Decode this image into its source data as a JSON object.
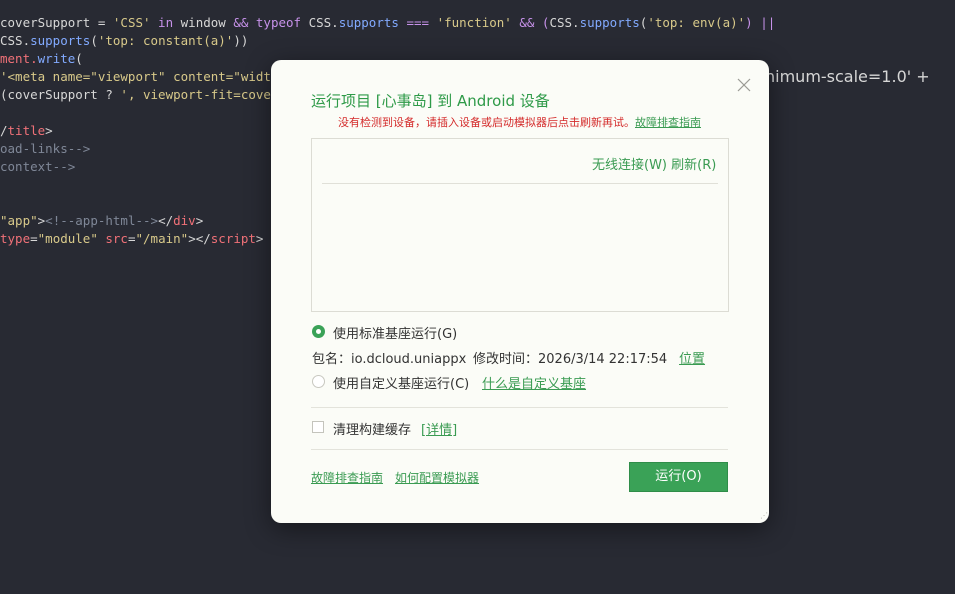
{
  "editor": {
    "lines": [
      {
        "tokens": [
          {
            "t": "coverSupport = ",
            "c": "plain"
          },
          {
            "t": "'CSS'",
            "c": "str"
          },
          {
            "t": " in ",
            "c": "kw"
          },
          {
            "t": "window ",
            "c": "plain"
          },
          {
            "t": "&& ",
            "c": "op"
          },
          {
            "t": "typeof ",
            "c": "kw"
          },
          {
            "t": "CSS.",
            "c": "plain"
          },
          {
            "t": "supports",
            "c": "fn"
          },
          {
            "t": " === ",
            "c": "op"
          },
          {
            "t": "'function'",
            "c": "str"
          },
          {
            "t": " && (",
            "c": "op"
          },
          {
            "t": "CSS.",
            "c": "plain"
          },
          {
            "t": "supports",
            "c": "fn"
          },
          {
            "t": "(",
            "c": "plain"
          },
          {
            "t": "'top: env(a)'",
            "c": "str"
          },
          {
            "t": ") ||",
            "c": "op"
          }
        ]
      },
      {
        "tokens": [
          {
            "t": "CSS.",
            "c": "plain"
          },
          {
            "t": "supports",
            "c": "fn"
          },
          {
            "t": "(",
            "c": "plain"
          },
          {
            "t": "'top: constant(a)'",
            "c": "str"
          },
          {
            "t": "))",
            "c": "plain"
          }
        ]
      },
      {
        "tokens": [
          {
            "t": "ment.",
            "c": "tag"
          },
          {
            "t": "write",
            "c": "fn"
          },
          {
            "t": "(",
            "c": "plain"
          }
        ]
      },
      {
        "tokens": [
          {
            "t": "'<meta name=\"viewport\" content=\"width=d",
            "c": "str"
          }
        ]
      },
      {
        "tokens": [
          {
            "t": "(coverSupport ? ",
            "c": "plain"
          },
          {
            "t": "', viewport-fit=cover'",
            "c": "str"
          }
        ]
      },
      {
        "tokens": [
          {
            "t": "/",
            "c": "plain"
          },
          {
            "t": "title",
            "c": "tag"
          },
          {
            "t": ">",
            "c": "plain"
          }
        ]
      },
      {
        "tokens": [
          {
            "t": "oad-links-->",
            "c": "cmt"
          }
        ]
      },
      {
        "tokens": [
          {
            "t": "context-->",
            "c": "cmt"
          }
        ]
      },
      {
        "tokens": []
      },
      {
        "tokens": []
      },
      {
        "tokens": [
          {
            "t": "\"app\"",
            "c": "str"
          },
          {
            "t": ">",
            "c": "plain"
          },
          {
            "t": "<!--app-html-->",
            "c": "cmt"
          },
          {
            "t": "</",
            "c": "plain"
          },
          {
            "t": "div",
            "c": "tag"
          },
          {
            "t": ">",
            "c": "plain"
          }
        ]
      },
      {
        "tokens": [
          {
            "t": "type",
            "c": "tag"
          },
          {
            "t": "=",
            "c": "plain"
          },
          {
            "t": "\"module\"",
            "c": "str"
          },
          {
            "t": " src",
            "c": "tag"
          },
          {
            "t": "=",
            "c": "plain"
          },
          {
            "t": "\"/main\"",
            "c": "str"
          },
          {
            "t": "></",
            "c": "plain"
          },
          {
            "t": "script",
            "c": "tag"
          },
          {
            "t": ">",
            "c": "plain"
          }
        ]
      }
    ],
    "overflow_text": "nimum-scale=1.0' +"
  },
  "dialog": {
    "title": "运行项目 [心事岛] 到 Android 设备",
    "warning_text": "没有检测到设备，请插入设备或启动模拟器后点击刷新再试。",
    "warning_link": "故障排查指南",
    "wireless_label": "无线连接(W)",
    "refresh_label": "刷新(R)",
    "standard_base_label": "使用标准基座运行(G)",
    "package_label": "包名：io.dcloud.uniappx",
    "modified_label": "修改时间：2026/3/14 22:17:54",
    "location_link": "位置",
    "custom_base_label": "使用自定义基座运行(C)",
    "custom_base_help_link": "什么是自定义基座",
    "clear_cache_label": "清理构建缓存",
    "details_link": "[详情]",
    "troubleshoot_link": "故障排查指南",
    "emulator_config_link": "如何配置模拟器",
    "run_button": "运行(O)",
    "standard_base_selected": true,
    "clear_cache_checked": false
  },
  "colors": {
    "accent": "#3aa257",
    "warning": "#d42b2b",
    "editor_bg": "#282a33",
    "dialog_bg": "#fbfcf7"
  },
  "icons": {
    "close": "close-icon",
    "resize": "resize-grip-icon"
  }
}
